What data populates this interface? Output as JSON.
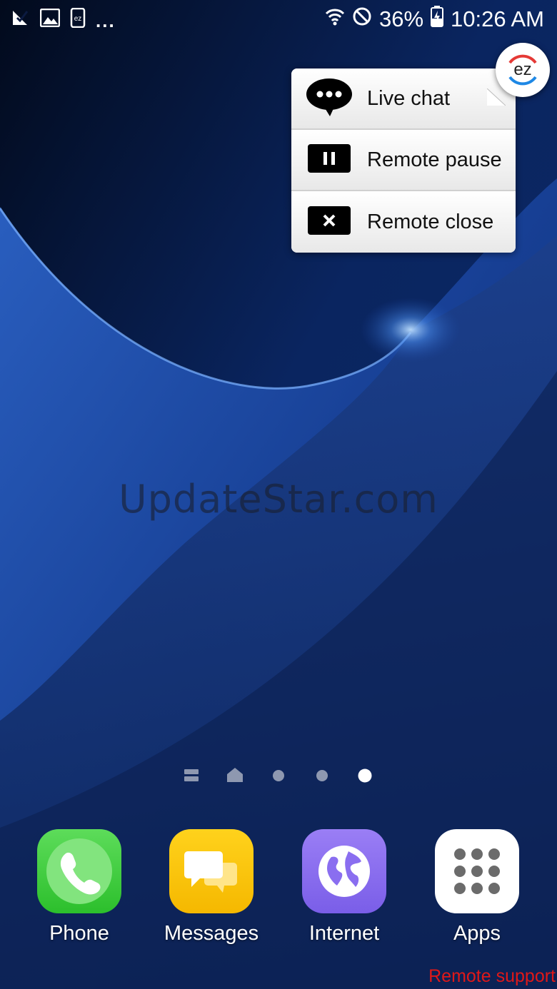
{
  "statusbar": {
    "battery": "36%",
    "time": "10:26 AM",
    "overflow": "...",
    "left_icons": [
      "notification-check-icon",
      "image-icon",
      "ez-phone-icon"
    ],
    "right_icons": [
      "wifi-icon",
      "do-not-disturb-icon",
      "battery-charging-icon"
    ]
  },
  "watermark": "UpdateStar.com",
  "popup": {
    "items": [
      {
        "label": "Live chat",
        "icon": "chat-bubble-icon"
      },
      {
        "label": "Remote pause",
        "icon": "pause-icon"
      },
      {
        "label": "Remote close",
        "icon": "close-icon"
      }
    ],
    "bubble_text": "ez"
  },
  "dock": {
    "apps": [
      {
        "label": "Phone",
        "icon": "phone-icon",
        "color": "#3fcf3f"
      },
      {
        "label": "Messages",
        "icon": "messages-icon",
        "color": "#f8c600"
      },
      {
        "label": "Internet",
        "icon": "globe-icon",
        "color": "#8a6ef0"
      },
      {
        "label": "Apps",
        "icon": "apps-grid-icon",
        "color": "#ffffff"
      }
    ]
  },
  "pager": {
    "pages": [
      "menu-lines-icon",
      "home-icon",
      "page-dot",
      "page-dot",
      "page-dot-active"
    ],
    "active_index": 4
  },
  "footer": {
    "remote_support": "Remote support"
  },
  "colors": {
    "accent_red": "#e01818",
    "ez_red": "#e53935",
    "ez_blue": "#1e88e5"
  }
}
